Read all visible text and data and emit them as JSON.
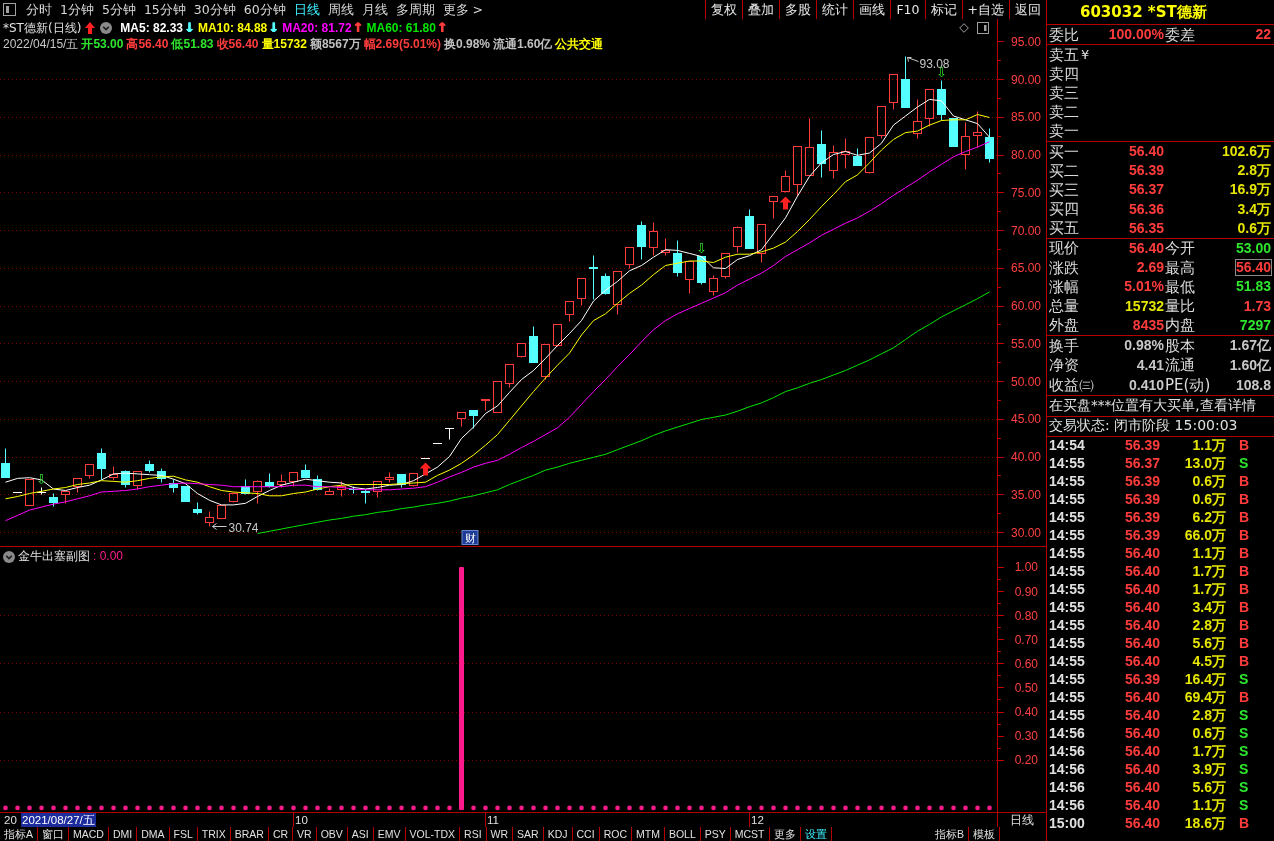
{
  "toolbar": {
    "periods": [
      {
        "label": "分时",
        "selected": false
      },
      {
        "label": "1分钟",
        "selected": false
      },
      {
        "label": "5分钟",
        "selected": false
      },
      {
        "label": "15分钟",
        "selected": false
      },
      {
        "label": "30分钟",
        "selected": false
      },
      {
        "label": "60分钟",
        "selected": false
      },
      {
        "label": "日线",
        "selected": true
      },
      {
        "label": "周线",
        "selected": false
      },
      {
        "label": "月线",
        "selected": false
      },
      {
        "label": "多周期",
        "selected": false
      },
      {
        "label": "更多 >",
        "selected": false
      }
    ],
    "actions": [
      "复权",
      "叠加",
      "多股",
      "统计",
      "画线",
      "F10",
      "标记",
      "+自选",
      "返回"
    ]
  },
  "main_chart": {
    "date": "2022/04/15/五",
    "quote": [
      {
        "text": "开53.00",
        "color": "#2ee62e"
      },
      {
        "text": "高56.40",
        "color": "#ff3c3c"
      },
      {
        "text": "低51.83",
        "color": "#2ee62e"
      },
      {
        "text": "收56.40",
        "color": "#ff3c3c"
      },
      {
        "text": "量15732",
        "color": "#ffff00"
      },
      {
        "text": "额8567万",
        "color": "#c0c0c0"
      },
      {
        "text": "幅2.69(5.01%)",
        "color": "#ff3c3c"
      },
      {
        "text": "换0.98%",
        "color": "#c0c0c0"
      },
      {
        "text": "流通1.60亿",
        "color": "#c0c0c0"
      },
      {
        "text": "公共交通",
        "color": "#ffff00"
      }
    ],
    "ma_arrows": [
      {
        "text": "↓",
        "color": "#54ffff"
      },
      {
        "text": "↓",
        "color": "#54ffff"
      },
      {
        "text": "↑",
        "color": "#ff3c3c"
      },
      {
        "text": "↑",
        "color": "#ff3c3c"
      }
    ],
    "signals": [
      {
        "kind": "none"
      },
      {
        "kind": "none"
      },
      {
        "kind": "none"
      },
      {
        "kind": "sell",
        "text": "⇩"
      },
      {
        "kind": "none"
      },
      {
        "kind": "none"
      },
      {
        "kind": "none"
      },
      {
        "kind": "none"
      },
      {
        "kind": "none"
      },
      {
        "kind": "none"
      },
      {
        "kind": "none"
      },
      {
        "kind": "none"
      },
      {
        "kind": "none"
      },
      {
        "kind": "none"
      },
      {
        "kind": "none"
      },
      {
        "kind": "none"
      },
      {
        "kind": "none"
      },
      {
        "kind": "none"
      },
      {
        "kind": "none"
      },
      {
        "kind": "none"
      },
      {
        "kind": "none"
      },
      {
        "kind": "none"
      },
      {
        "kind": "none"
      },
      {
        "kind": "none"
      },
      {
        "kind": "none"
      },
      {
        "kind": "none"
      },
      {
        "kind": "none"
      },
      {
        "kind": "none"
      },
      {
        "kind": "none"
      },
      {
        "kind": "none"
      },
      {
        "kind": "none"
      },
      {
        "kind": "none"
      },
      {
        "kind": "none"
      },
      {
        "kind": "none"
      },
      {
        "kind": "none"
      },
      {
        "kind": "buy"
      },
      {
        "kind": "none"
      },
      {
        "kind": "none"
      },
      {
        "kind": "event",
        "text": "财"
      },
      {
        "kind": "none"
      },
      {
        "kind": "none"
      },
      {
        "kind": "none"
      },
      {
        "kind": "none"
      },
      {
        "kind": "none"
      },
      {
        "kind": "none"
      },
      {
        "kind": "none"
      },
      {
        "kind": "none"
      },
      {
        "kind": "none"
      },
      {
        "kind": "none"
      },
      {
        "kind": "none"
      },
      {
        "kind": "none"
      },
      {
        "kind": "none"
      },
      {
        "kind": "none"
      },
      {
        "kind": "none"
      },
      {
        "kind": "none"
      },
      {
        "kind": "none"
      },
      {
        "kind": "none"
      },
      {
        "kind": "none"
      },
      {
        "kind": "sell",
        "text": "⇩"
      },
      {
        "kind": "none"
      },
      {
        "kind": "none"
      },
      {
        "kind": "none"
      },
      {
        "kind": "none"
      },
      {
        "kind": "none"
      },
      {
        "kind": "none"
      },
      {
        "kind": "buy"
      },
      {
        "kind": "none"
      },
      {
        "kind": "none"
      },
      {
        "kind": "none"
      },
      {
        "kind": "none"
      },
      {
        "kind": "none"
      },
      {
        "kind": "none"
      },
      {
        "kind": "none"
      },
      {
        "kind": "none"
      },
      {
        "kind": "none"
      },
      {
        "kind": "none"
      },
      {
        "kind": "none"
      },
      {
        "kind": "none"
      },
      {
        "kind": "sell",
        "text": "⇩"
      },
      {
        "kind": "none"
      },
      {
        "kind": "none"
      },
      {
        "kind": "none"
      },
      {
        "kind": "none"
      }
    ],
    "chart_data": {
      "type": "candlestick",
      "title": "*ST德新(日线)",
      "legend": "top",
      "grid": true,
      "ylim": [
        28.15,
        97.95
      ],
      "yticks": [
        {
          "value": 95,
          "label": "95.00"
        },
        {
          "value": 90,
          "label": "90.00"
        },
        {
          "value": 85,
          "label": "85.00"
        },
        {
          "value": 80,
          "label": "80.00"
        },
        {
          "value": 75,
          "label": "75.00"
        },
        {
          "value": 70,
          "label": "70.00"
        },
        {
          "value": 65,
          "label": "65.00"
        },
        {
          "value": 60,
          "label": "60.00"
        },
        {
          "value": 55,
          "label": "55.00"
        },
        {
          "value": 50,
          "label": "50.00"
        },
        {
          "value": 45,
          "label": "45.00"
        },
        {
          "value": 40,
          "label": "40.00"
        },
        {
          "value": 35,
          "label": "35.00"
        },
        {
          "value": 30,
          "label": "30.00"
        }
      ],
      "ohlc": [
        [
          39.2,
          41.15,
          37.3,
          37.3
        ],
        [
          35.3,
          35.3,
          35.3,
          35.3
        ],
        [
          33.6,
          37.0,
          33.6,
          37.0
        ],
        [
          35.3,
          35.9,
          35.1,
          35.3
        ],
        [
          34.7,
          35.2,
          33.5,
          33.95
        ],
        [
          35.0,
          35.5,
          33.9,
          35.45
        ],
        [
          36.15,
          37.2,
          35.3,
          37.15
        ],
        [
          37.6,
          39.05,
          37.2,
          39.0
        ],
        [
          40.5,
          41.1,
          37.0,
          38.5
        ],
        [
          37.25,
          38.8,
          36.9,
          37.7
        ],
        [
          38.05,
          38.2,
          35.9,
          36.4
        ],
        [
          36.25,
          38.1,
          35.7,
          38.05
        ],
        [
          38.95,
          39.55,
          37.9,
          38.15
        ],
        [
          38.05,
          38.5,
          36.6,
          37.15
        ],
        [
          36.45,
          37.0,
          35.3,
          35.9
        ],
        [
          36.05,
          36.1,
          34.1,
          34.15
        ],
        [
          33.05,
          33.95,
          32.4,
          32.6
        ],
        [
          31.3,
          32.85,
          30.74,
          31.95
        ],
        [
          31.85,
          33.6,
          31.85,
          33.6
        ],
        [
          34.05,
          35.25,
          33.95,
          35.2
        ],
        [
          36.15,
          37.0,
          35.1,
          35.2
        ],
        [
          35.4,
          36.85,
          33.9,
          36.8
        ],
        [
          36.6,
          37.8,
          35.9,
          36.15
        ],
        [
          36.4,
          37.7,
          35.9,
          36.75
        ],
        [
          36.75,
          38.0,
          36.15,
          37.95
        ],
        [
          38.25,
          38.95,
          37.3,
          37.35
        ],
        [
          37.05,
          37.6,
          35.6,
          35.7
        ],
        [
          35.05,
          35.8,
          35.0,
          35.5
        ],
        [
          35.7,
          36.8,
          34.8,
          36.05
        ],
        [
          35.75,
          36.15,
          35.2,
          35.7
        ],
        [
          35.5,
          35.7,
          33.9,
          35.3
        ],
        [
          35.5,
          36.8,
          34.6,
          36.8
        ],
        [
          37.0,
          37.9,
          36.6,
          37.35
        ],
        [
          37.7,
          37.7,
          36.0,
          36.4
        ],
        [
          36.2,
          37.8,
          36.1,
          37.8
        ],
        [
          39.8,
          39.8,
          39.8,
          39.8
        ],
        [
          41.75,
          41.75,
          41.75,
          41.75
        ],
        [
          43.8,
          43.8,
          42.35,
          43.8
        ],
        [
          45.1,
          45.9,
          44.0,
          45.9
        ],
        [
          46.1,
          46.1,
          43.8,
          45.45
        ],
        [
          47.5,
          47.65,
          46.1,
          47.65
        ],
        [
          45.95,
          50.0,
          45.9,
          50.0
        ],
        [
          49.7,
          52.3,
          49.25,
          52.3
        ],
        [
          53.25,
          55.0,
          53.2,
          55.0
        ],
        [
          56.0,
          57.25,
          52.5,
          52.55
        ],
        [
          50.65,
          54.95,
          50.3,
          54.9
        ],
        [
          54.8,
          57.6,
          54.7,
          57.6
        ],
        [
          58.9,
          60.6,
          58.0,
          60.55
        ],
        [
          61.0,
          63.65,
          60.1,
          63.6
        ],
        [
          65.1,
          66.7,
          60.8,
          65.0
        ],
        [
          63.95,
          64.3,
          61.5,
          61.6
        ],
        [
          60.2,
          64.6,
          58.9,
          64.55
        ],
        [
          65.5,
          67.8,
          65.0,
          67.75
        ],
        [
          70.6,
          71.25,
          66.2,
          67.85
        ],
        [
          67.75,
          71.05,
          66.7,
          69.9
        ],
        [
          67.15,
          68.9,
          66.7,
          67.4
        ],
        [
          67.0,
          68.7,
          63.85,
          64.45
        ],
        [
          63.5,
          65.95,
          61.7,
          65.95
        ],
        [
          66.6,
          66.6,
          62.9,
          63.15
        ],
        [
          61.95,
          64.0,
          61.35,
          63.7
        ],
        [
          63.85,
          66.95,
          63.6,
          66.9
        ],
        [
          67.95,
          70.5,
          67.15,
          70.45
        ],
        [
          71.85,
          72.8,
          67.6,
          67.6
        ],
        [
          67.0,
          70.8,
          65.7,
          70.75
        ],
        [
          73.9,
          74.45,
          71.6,
          74.45
        ],
        [
          75.15,
          78.0,
          75.1,
          77.2
        ],
        [
          76.1,
          81.15,
          74.7,
          81.15
        ],
        [
          77.35,
          84.8,
          77.3,
          81.05
        ],
        [
          81.4,
          83.3,
          77.05,
          78.9
        ],
        [
          78.0,
          81.3,
          76.9,
          80.35
        ],
        [
          80.1,
          82.2,
          78.2,
          80.5
        ],
        [
          79.85,
          80.8,
          78.6,
          78.6
        ],
        [
          77.75,
          82.35,
          77.5,
          82.35
        ],
        [
          82.55,
          86.45,
          82.2,
          86.45
        ],
        [
          86.95,
          90.7,
          86.0,
          90.7
        ],
        [
          90.0,
          93.08,
          86.3,
          86.3
        ],
        [
          82.85,
          87.4,
          82.2,
          84.45
        ],
        [
          84.9,
          88.7,
          83.8,
          88.7
        ],
        [
          88.7,
          89.85,
          84.6,
          85.4
        ],
        [
          84.9,
          84.9,
          81.15,
          81.15
        ],
        [
          80.1,
          84.35,
          78.1,
          82.45
        ],
        [
          82.6,
          85.75,
          81.05,
          82.95
        ],
        [
          82.35,
          83.5,
          79.05,
          79.6
        ]
      ],
      "series": [
        {
          "name": "MA5: 82.33",
          "type": "line",
          "color": "#ffffff",
          "values": [
            36.6,
            37.1,
            37.2,
            36.9,
            35.7,
            35.5,
            35.9,
            36.2,
            36.9,
            37.7,
            37.8,
            37.7,
            37.6,
            37.5,
            37.0,
            36.4,
            35.1,
            34.2,
            33.6,
            33.6,
            33.8,
            34.7,
            35.5,
            36.2,
            36.6,
            37.0,
            36.8,
            36.6,
            36.5,
            35.9,
            35.7,
            35.9,
            36.2,
            36.3,
            36.8,
            37.7,
            38.6,
            40.0,
            42.4,
            43.9,
            45.7,
            46.7,
            48.5,
            50.2,
            51.4,
            53.0,
            54.7,
            56.3,
            58.0,
            60.6,
            62.0,
            63.2,
            64.6,
            65.3,
            66.4,
            67.4,
            67.3,
            66.9,
            66.5,
            65.0,
            64.9,
            66.1,
            66.6,
            67.4,
            69.5,
            71.6,
            74.5,
            77.1,
            78.9,
            80.0,
            80.4,
            79.9,
            80.2,
            81.5,
            83.9,
            85.1,
            86.3,
            87.3,
            87.1,
            85.1,
            84.6,
            84.1,
            82.3
          ]
        },
        {
          "name": "MA10: 84.88",
          "type": "line",
          "color": "#ffff00",
          "values": [
            34.4,
            34.7,
            35.1,
            35.4,
            35.7,
            35.9,
            36.3,
            36.5,
            36.8,
            36.7,
            36.6,
            36.8,
            37.1,
            37.3,
            37.4,
            36.9,
            36.6,
            36.0,
            35.5,
            35.3,
            35.2,
            35.1,
            34.8,
            34.8,
            35.1,
            35.3,
            35.7,
            36.0,
            36.2,
            36.3,
            36.3,
            36.3,
            36.3,
            36.4,
            36.5,
            36.6,
            37.5,
            38.2,
            39.1,
            40.2,
            41.5,
            42.9,
            44.8,
            46.7,
            48.6,
            50.4,
            52.1,
            53.7,
            56.1,
            58.0,
            58.9,
            60.3,
            61.6,
            62.7,
            64.1,
            65.3,
            65.6,
            65.9,
            65.9,
            65.7,
            66.4,
            66.8,
            66.8,
            67.1,
            67.6,
            68.4,
            69.8,
            71.4,
            73.1,
            74.7,
            76.4,
            77.3,
            78.9,
            80.6,
            82.0,
            82.9,
            83.1,
            83.9,
            84.5,
            84.6,
            84.6,
            85.3,
            84.9
          ]
        },
        {
          "name": "MA20: 81.72",
          "type": "line",
          "color": "#ff00ff",
          "values": [
            31.5,
            32.2,
            32.9,
            33.3,
            33.7,
            34.0,
            34.4,
            34.8,
            35.3,
            35.4,
            35.5,
            35.7,
            36.0,
            36.2,
            36.4,
            36.5,
            36.4,
            36.3,
            36.2,
            36.0,
            36.0,
            36.0,
            36.0,
            36.0,
            36.2,
            36.2,
            36.0,
            36.0,
            35.9,
            35.7,
            35.6,
            35.6,
            35.6,
            35.7,
            35.8,
            36.0,
            36.6,
            37.3,
            37.9,
            38.6,
            39.1,
            39.5,
            40.3,
            41.2,
            42.0,
            42.9,
            43.8,
            45.2,
            46.9,
            48.6,
            50.2,
            51.9,
            53.5,
            55.2,
            56.8,
            58.0,
            58.9,
            59.6,
            60.3,
            61.0,
            61.7,
            62.7,
            63.5,
            64.3,
            65.3,
            66.5,
            67.4,
            68.3,
            69.3,
            70.1,
            70.9,
            71.6,
            72.5,
            73.5,
            74.6,
            75.6,
            76.6,
            77.7,
            78.7,
            79.7,
            80.4,
            81.0,
            81.7
          ]
        },
        {
          "name": "MA60: 61.80",
          "type": "line",
          "color": "#00e600",
          "values": [
            null,
            null,
            null,
            null,
            null,
            null,
            null,
            null,
            null,
            null,
            null,
            null,
            null,
            null,
            null,
            null,
            null,
            null,
            null,
            null,
            null,
            29.8,
            30.1,
            30.4,
            30.7,
            31.0,
            31.3,
            31.6,
            31.8,
            32.1,
            32.3,
            32.6,
            32.8,
            33.1,
            33.3,
            33.6,
            33.8,
            34.1,
            34.5,
            34.8,
            35.2,
            35.6,
            36.3,
            36.9,
            37.5,
            38.2,
            38.6,
            39.1,
            39.5,
            39.9,
            40.3,
            40.9,
            41.5,
            42.1,
            42.8,
            43.4,
            43.9,
            44.4,
            44.9,
            45.2,
            45.5,
            46.0,
            46.6,
            47.1,
            47.8,
            48.6,
            49.1,
            49.7,
            50.2,
            50.8,
            51.4,
            52.1,
            52.8,
            53.6,
            54.4,
            55.5,
            56.6,
            57.5,
            58.5,
            59.3,
            60.1,
            60.9,
            61.8
          ]
        }
      ],
      "annotations": [
        "93.08",
        "30.74"
      ]
    }
  },
  "indicator_panel": {
    "reading": ": 0.00",
    "period_label": "日线",
    "cursor_date": "2021/08/27/五",
    "axis_labels": [
      "20",
      "10",
      "11",
      "12"
    ],
    "chart_data": {
      "type": "bar",
      "title": "金牛出塞副图",
      "grid": true,
      "ylim": [
        -0.017,
        1.083
      ],
      "yticks": [
        {
          "value": 1,
          "label": "1.00"
        },
        {
          "value": 0.9,
          "label": "0.90"
        },
        {
          "value": 0.8,
          "label": "0.80"
        },
        {
          "value": 0.7,
          "label": "0.70"
        },
        {
          "value": 0.6,
          "label": "0.60"
        },
        {
          "value": 0.5,
          "label": "0.50"
        },
        {
          "value": 0.4,
          "label": "0.40"
        },
        {
          "value": 0.3,
          "label": "0.30"
        },
        {
          "value": 0.2,
          "label": "0.20"
        }
      ],
      "values": [
        0,
        0,
        0,
        0,
        0,
        0,
        0,
        0,
        0,
        0,
        0,
        0,
        0,
        0,
        0,
        0,
        0,
        0,
        0,
        0,
        0,
        0,
        0,
        0,
        0,
        0,
        0,
        0,
        0,
        0,
        0,
        0,
        0,
        0,
        0,
        0,
        0,
        0,
        1,
        0,
        0,
        0,
        0,
        0,
        0,
        0,
        0,
        0,
        0,
        0,
        0,
        0,
        0,
        0,
        0,
        0,
        0,
        0,
        0,
        0,
        0,
        0,
        0,
        0,
        0,
        0,
        0,
        0,
        0,
        0,
        0,
        0,
        0,
        0,
        0,
        0,
        0,
        0,
        0,
        0,
        0,
        0,
        0
      ]
    }
  },
  "indicator_tabs": [
    {
      "label": "指标A",
      "selected": false
    },
    {
      "label": "窗口",
      "selected": false
    },
    {
      "label": "MACD",
      "selected": false
    },
    {
      "label": "DMI",
      "selected": false
    },
    {
      "label": "DMA",
      "selected": false
    },
    {
      "label": "FSL",
      "selected": false
    },
    {
      "label": "TRIX",
      "selected": false
    },
    {
      "label": "BRAR",
      "selected": false
    },
    {
      "label": "CR",
      "selected": false
    },
    {
      "label": "VR",
      "selected": false
    },
    {
      "label": "OBV",
      "selected": false
    },
    {
      "label": "ASI",
      "selected": false
    },
    {
      "label": "EMV",
      "selected": false
    },
    {
      "label": "VOL-TDX",
      "selected": false
    },
    {
      "label": "RSI",
      "selected": false
    },
    {
      "label": "WR",
      "selected": false
    },
    {
      "label": "SAR",
      "selected": false
    },
    {
      "label": "KDJ",
      "selected": false
    },
    {
      "label": "CCI",
      "selected": false
    },
    {
      "label": "ROC",
      "selected": false
    },
    {
      "label": "MTM",
      "selected": false
    },
    {
      "label": "BOLL",
      "selected": false
    },
    {
      "label": "PSY",
      "selected": false
    },
    {
      "label": "MCST",
      "selected": false
    },
    {
      "label": "更多",
      "selected": false
    },
    {
      "label": "设置",
      "selected": true
    }
  ],
  "template_tabs": [
    "指标B",
    "模板"
  ],
  "quote_panel": {
    "title": "603032 *ST德新",
    "order_ratio": [
      {
        "label": "委比",
        "value": "100.00%"
      },
      {
        "label": "委差",
        "value": "22"
      }
    ],
    "asks": [
      {
        "label": "卖五",
        "currency_mark": "¥"
      },
      {
        "label": "卖四"
      },
      {
        "label": "卖三"
      },
      {
        "label": "卖二"
      },
      {
        "label": "卖一"
      }
    ],
    "bids": [
      {
        "label": "买一",
        "price": "56.40",
        "volume": "102.6万"
      },
      {
        "label": "买二",
        "price": "56.39",
        "volume": "2.8万"
      },
      {
        "label": "买三",
        "price": "56.37",
        "volume": "16.9万"
      },
      {
        "label": "买四",
        "price": "56.36",
        "volume": "3.4万"
      },
      {
        "label": "买五",
        "price": "56.35",
        "volume": "0.6万"
      }
    ],
    "stats": [
      {
        "label": "现价",
        "value": "56.40",
        "color": "#ff3c3c",
        "boxed": false
      },
      {
        "label": "今开",
        "value": "53.00",
        "color": "#2ee62e",
        "boxed": false
      },
      {
        "label": "涨跌",
        "value": "2.69",
        "color": "#ff3c3c",
        "boxed": false
      },
      {
        "label": "最高",
        "value": "56.40",
        "color": "#ff3c3c",
        "boxed": true
      },
      {
        "label": "涨幅",
        "value": "5.01%",
        "color": "#ff3c3c",
        "boxed": false
      },
      {
        "label": "最低",
        "value": "51.83",
        "color": "#2ee62e",
        "boxed": false
      },
      {
        "label": "总量",
        "value": "15732",
        "color": "#e6e600",
        "boxed": false
      },
      {
        "label": "量比",
        "value": "1.73",
        "color": "#ff3c3c",
        "boxed": false
      },
      {
        "label": "外盘",
        "value": "8435",
        "color": "#ff3c3c",
        "boxed": false
      },
      {
        "label": "内盘",
        "value": "7297",
        "color": "#2ee62e",
        "boxed": false
      }
    ],
    "fundamentals": [
      {
        "label": "换手",
        "value": "0.98%"
      },
      {
        "label": "股本",
        "value": "1.67亿"
      },
      {
        "label": "净资",
        "value": "4.41"
      },
      {
        "label": "流通",
        "value": "1.60亿"
      },
      {
        "label": "收益㈢",
        "value": "0.410"
      },
      {
        "label": "PE(动)",
        "value": "108.8"
      }
    ],
    "notice": "在买盘***位置有大买单,查看详情",
    "status": "交易状态: 闭市阶段 15:00:03",
    "trades": [
      {
        "time": "14:54",
        "price": "56.39",
        "volume": "1.1万",
        "side": "B",
        "kind": "buy"
      },
      {
        "time": "14:55",
        "price": "56.37",
        "volume": "13.0万",
        "side": "S",
        "kind": "sell"
      },
      {
        "time": "14:55",
        "price": "56.39",
        "volume": "0.6万",
        "side": "B",
        "kind": "buy"
      },
      {
        "time": "14:55",
        "price": "56.39",
        "volume": "0.6万",
        "side": "B",
        "kind": "buy"
      },
      {
        "time": "14:55",
        "price": "56.39",
        "volume": "6.2万",
        "side": "B",
        "kind": "buy"
      },
      {
        "time": "14:55",
        "price": "56.39",
        "volume": "66.0万",
        "side": "B",
        "kind": "buy"
      },
      {
        "time": "14:55",
        "price": "56.40",
        "volume": "1.1万",
        "side": "B",
        "kind": "buy"
      },
      {
        "time": "14:55",
        "price": "56.40",
        "volume": "1.7万",
        "side": "B",
        "kind": "buy"
      },
      {
        "time": "14:55",
        "price": "56.40",
        "volume": "1.7万",
        "side": "B",
        "kind": "buy"
      },
      {
        "time": "14:55",
        "price": "56.40",
        "volume": "3.4万",
        "side": "B",
        "kind": "buy"
      },
      {
        "time": "14:55",
        "price": "56.40",
        "volume": "2.8万",
        "side": "B",
        "kind": "buy"
      },
      {
        "time": "14:55",
        "price": "56.40",
        "volume": "5.6万",
        "side": "B",
        "kind": "buy"
      },
      {
        "time": "14:55",
        "price": "56.40",
        "volume": "4.5万",
        "side": "B",
        "kind": "buy"
      },
      {
        "time": "14:55",
        "price": "56.39",
        "volume": "16.4万",
        "side": "S",
        "kind": "sell"
      },
      {
        "time": "14:55",
        "price": "56.40",
        "volume": "69.4万",
        "side": "B",
        "kind": "buy"
      },
      {
        "time": "14:55",
        "price": "56.40",
        "volume": "2.8万",
        "side": "S",
        "kind": "sell"
      },
      {
        "time": "14:56",
        "price": "56.40",
        "volume": "0.6万",
        "side": "S",
        "kind": "sell"
      },
      {
        "time": "14:56",
        "price": "56.40",
        "volume": "1.7万",
        "side": "S",
        "kind": "sell"
      },
      {
        "time": "14:56",
        "price": "56.40",
        "volume": "3.9万",
        "side": "S",
        "kind": "sell"
      },
      {
        "time": "14:56",
        "price": "56.40",
        "volume": "5.6万",
        "side": "S",
        "kind": "sell"
      },
      {
        "time": "14:56",
        "price": "56.40",
        "volume": "1.1万",
        "side": "S",
        "kind": "sell"
      },
      {
        "time": "15:00",
        "price": "56.40",
        "volume": "18.6万",
        "side": "B",
        "kind": "buy"
      }
    ]
  }
}
